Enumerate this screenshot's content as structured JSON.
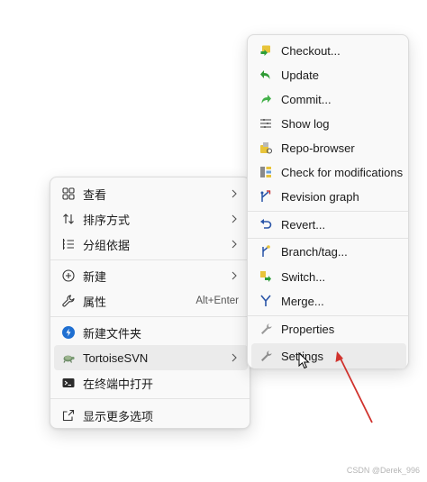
{
  "main_menu": {
    "items": [
      {
        "label": "查看",
        "icon": "grid-view-icon",
        "submenu": true
      },
      {
        "label": "排序方式",
        "icon": "sort-arrows-icon",
        "submenu": true
      },
      {
        "label": "分组依据",
        "icon": "list-group-icon",
        "submenu": true
      },
      {
        "label": "新建",
        "icon": "plus-circle-icon",
        "submenu": true
      },
      {
        "label": "属性",
        "icon": "wrench-icon",
        "shortcut": "Alt+Enter"
      },
      {
        "label": "新建文件夹",
        "icon": "folder-icon"
      },
      {
        "label": "TortoiseSVN",
        "icon": "tortoise-icon",
        "submenu": true,
        "highlighted": true
      },
      {
        "label": "在终端中打开",
        "icon": "terminal-icon"
      },
      {
        "label": "显示更多选项",
        "icon": "share-icon"
      }
    ]
  },
  "sub_menu": {
    "items": [
      {
        "label": "Checkout...",
        "icon": "checkout-icon"
      },
      {
        "label": "Update",
        "icon": "update-icon"
      },
      {
        "label": "Commit...",
        "icon": "commit-icon"
      },
      {
        "label": "Show log",
        "icon": "show-log-icon"
      },
      {
        "label": "Repo-browser",
        "icon": "repo-browser-icon"
      },
      {
        "label": "Check for modifications",
        "icon": "check-modifications-icon"
      },
      {
        "label": "Revision graph",
        "icon": "revision-graph-icon"
      },
      {
        "label": "Revert...",
        "icon": "revert-icon"
      },
      {
        "label": "Branch/tag...",
        "icon": "branch-tag-icon"
      },
      {
        "label": "Switch...",
        "icon": "switch-icon"
      },
      {
        "label": "Merge...",
        "icon": "merge-icon"
      },
      {
        "label": "Properties",
        "icon": "properties-icon"
      },
      {
        "label": "Settings",
        "icon": "settings-icon",
        "highlighted": true
      }
    ]
  },
  "watermark": "CSDN @Derek_996",
  "colors": {
    "menu_bg": "#f9f9f9",
    "hover_bg": "#ebebeb",
    "annotation_arrow": "#d0322d",
    "accent_blue": "#1f5fbf"
  }
}
